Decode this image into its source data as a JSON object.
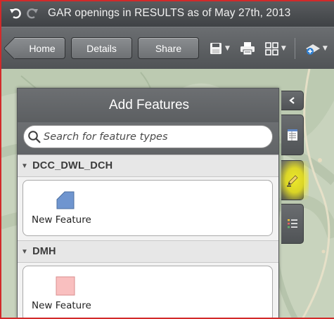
{
  "titlebar": {
    "title": "GAR openings in RESULTS as of May 27th, 2013",
    "undo_icon": "undo-icon",
    "redo_icon": "redo-icon"
  },
  "toolbar": {
    "home_label": "Home",
    "details_label": "Details",
    "share_label": "Share",
    "tools": [
      "save-icon",
      "print-icon",
      "basemap-gallery-icon",
      "add-data-icon"
    ]
  },
  "panel": {
    "title": "Add Features",
    "search_placeholder": "Search for feature types",
    "groups": [
      {
        "name": "DCC_DWL_DCH",
        "feature": {
          "label": "New Feature",
          "color": "#6f95cf",
          "shape": "polygon"
        }
      },
      {
        "name": "DMH",
        "feature": {
          "label": "New Feature",
          "color": "#f9bfbf",
          "shape": "square"
        }
      }
    ]
  },
  "side_tabs": [
    "collapse-icon",
    "attribute-table-icon",
    "edit-pencil-icon",
    "legend-icon"
  ],
  "colors": {
    "frame": "#d22a2a",
    "highlight": "#f5f028",
    "polygon_fill": "#6f95cf",
    "square_fill": "#f9bfbf"
  }
}
